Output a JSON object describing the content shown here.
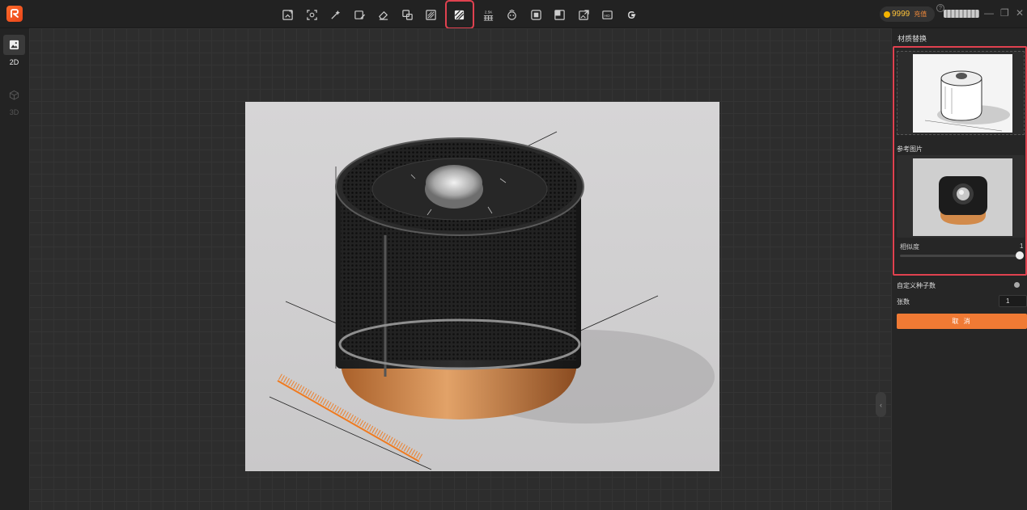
{
  "toolbar": {
    "tools": [
      {
        "icon": "image-expand-icon"
      },
      {
        "icon": "face-scan-icon"
      },
      {
        "icon": "magic-wand-icon"
      },
      {
        "icon": "image-edit-icon"
      },
      {
        "icon": "eraser-icon"
      },
      {
        "icon": "crop-icon"
      },
      {
        "icon": "texture-icon"
      },
      {
        "icon": "material-replace-icon",
        "active": true
      },
      {
        "icon": "upscale-2x-icon",
        "badge": "2.5K"
      },
      {
        "icon": "face-swap-icon"
      },
      {
        "icon": "layer-front-icon"
      },
      {
        "icon": "layer-split-icon"
      },
      {
        "icon": "image-share-icon"
      },
      {
        "icon": "hd-icon"
      },
      {
        "icon": "google-icon"
      }
    ],
    "accent": "#e0414f"
  },
  "account": {
    "coins": "9999",
    "recharge": "充值"
  },
  "modes": [
    {
      "label": "2D",
      "active": true
    },
    {
      "label": "3D",
      "active": false
    }
  ],
  "panel": {
    "title": "材质替换",
    "reference_label": "参考图片",
    "similarity_label": "相似度",
    "similarity_value": "1",
    "similarity": 1.0,
    "custom_seed_label": "自定义种子数",
    "count_label": "张数",
    "count_value": "1",
    "cancel_label": "取 消",
    "button_color": "#f07a34"
  }
}
